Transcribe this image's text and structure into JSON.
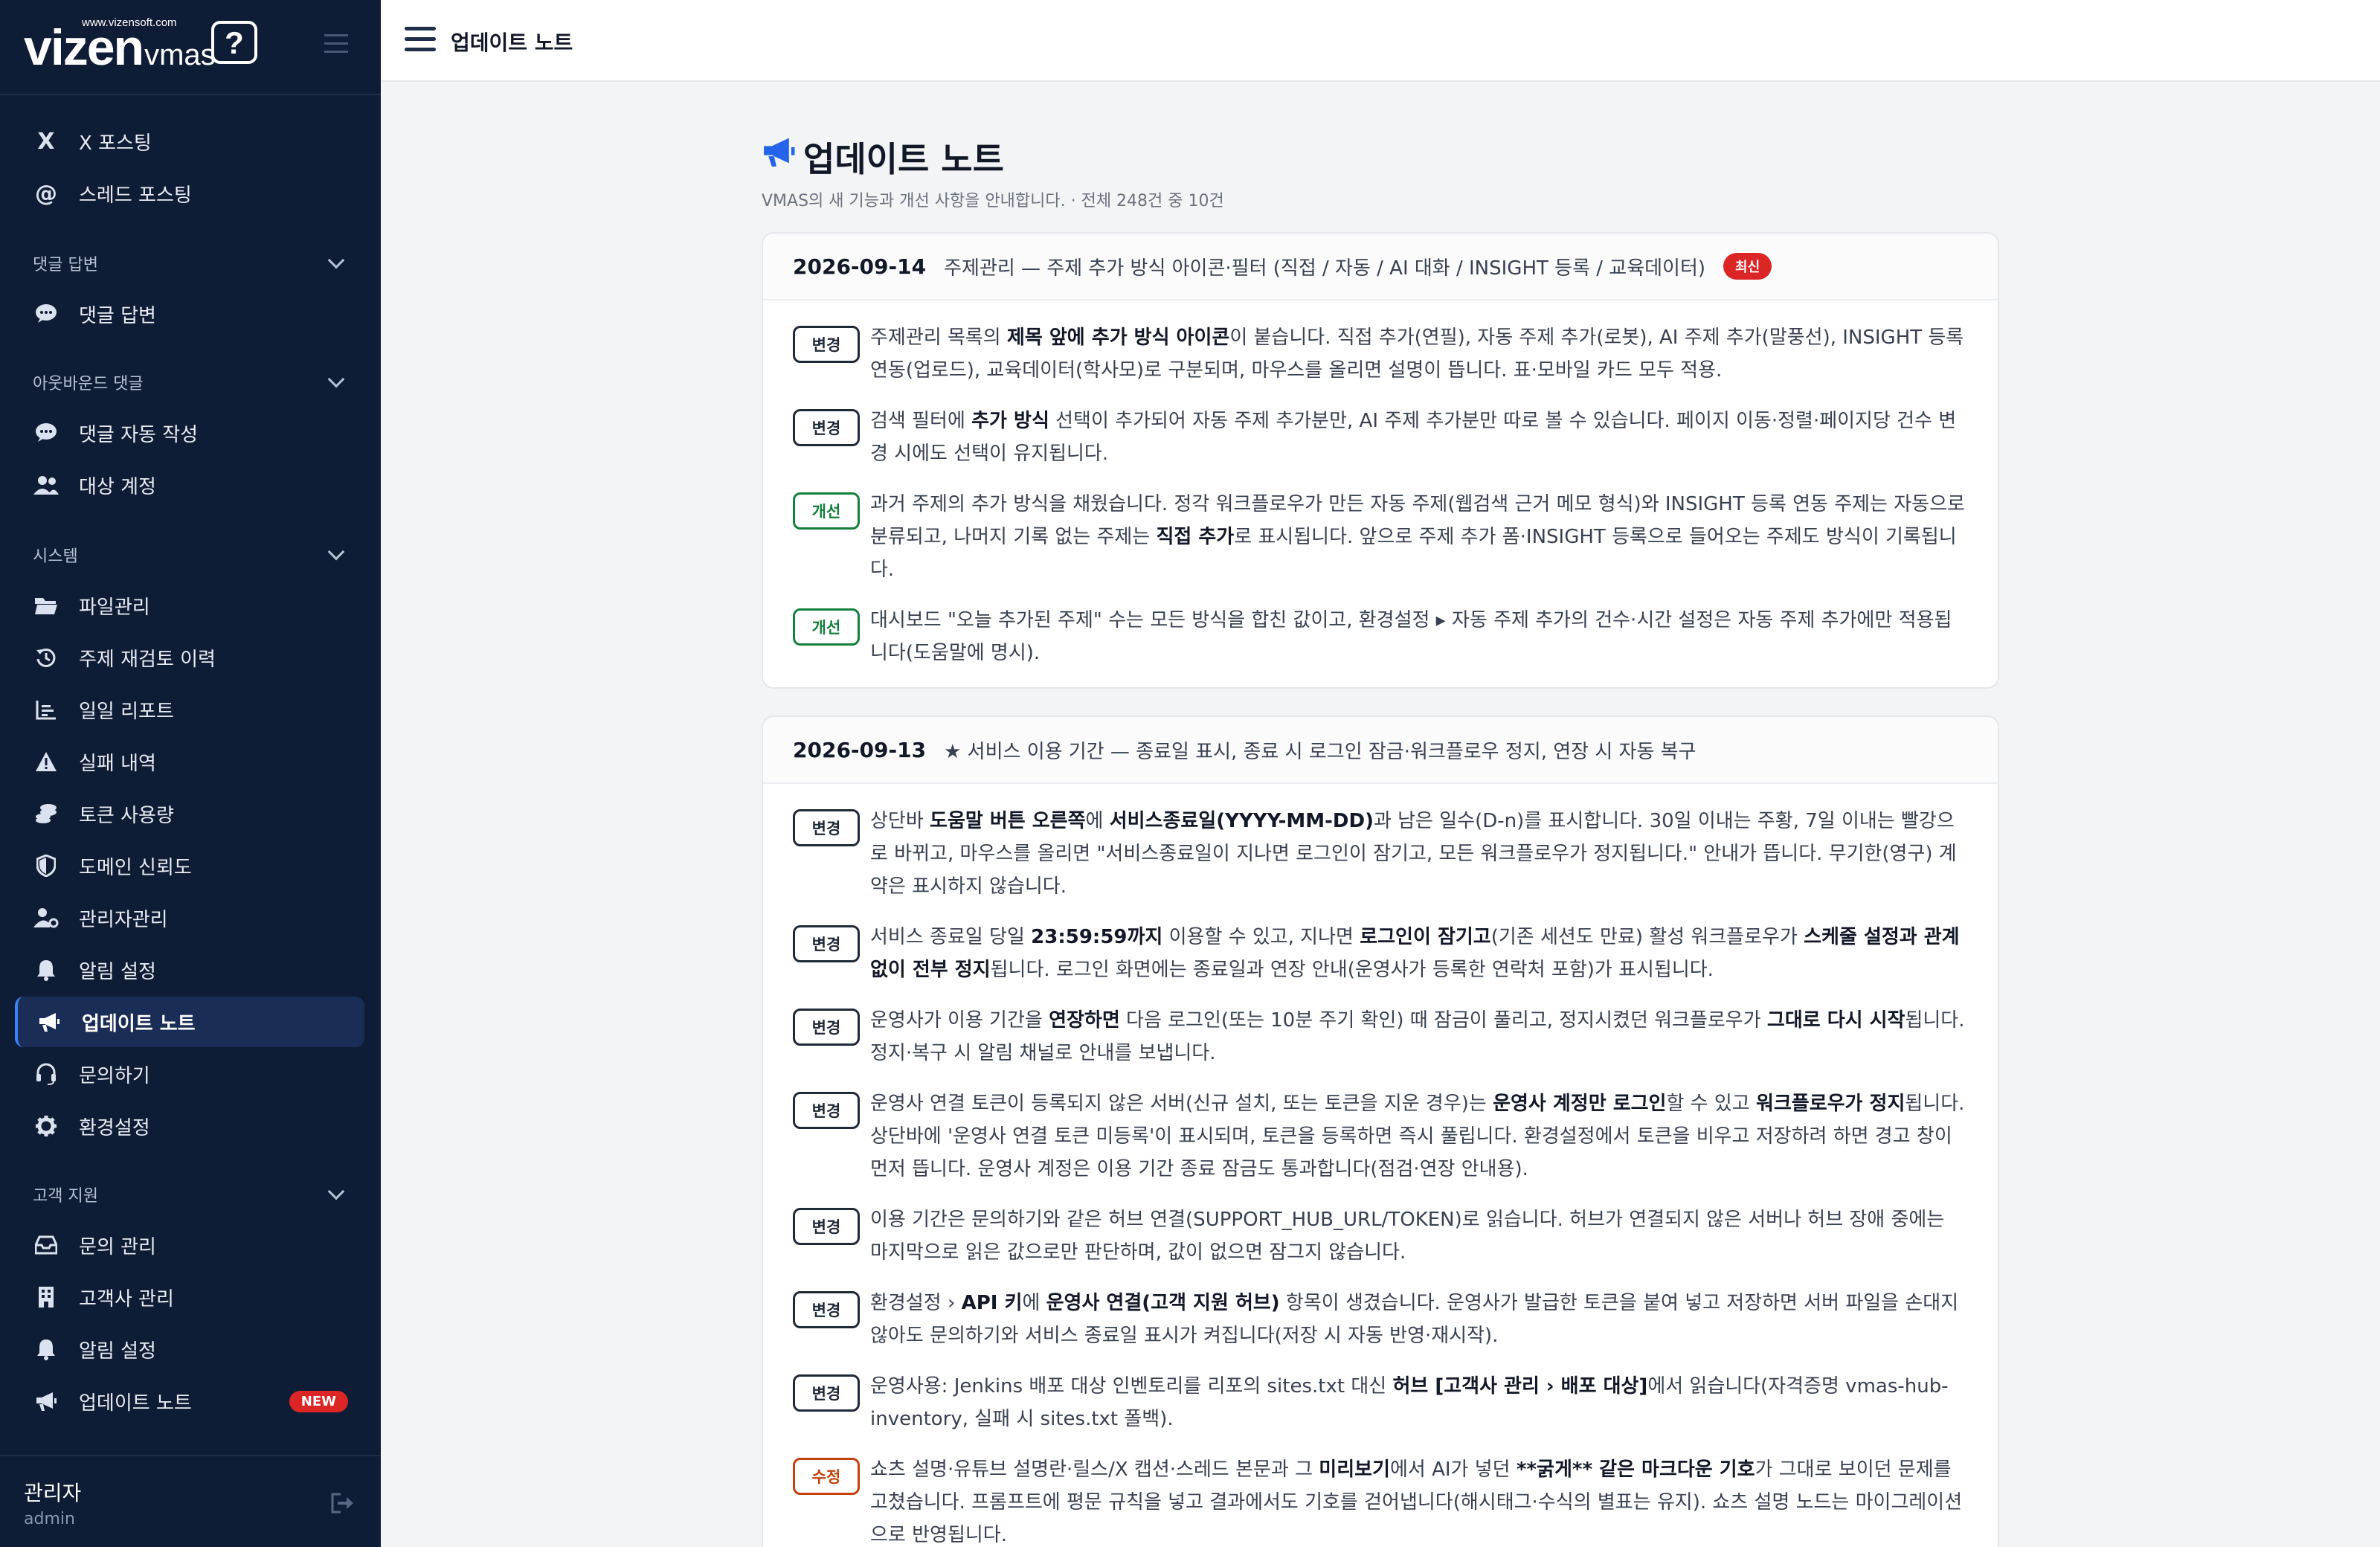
{
  "brand": {
    "url": "www.vizensoft.com",
    "name": "vizen",
    "product": "vmas",
    "bubble": "?"
  },
  "sidebar": {
    "items_top": [
      {
        "label": "X 포스팅",
        "icon": "x-icon"
      },
      {
        "label": "스레드 포스팅",
        "icon": "at-icon"
      }
    ],
    "section_comment": "댓글 답변",
    "comment_items": [
      {
        "label": "댓글 답변",
        "icon": "comment-icon"
      }
    ],
    "section_outbound": "아웃바운드 댓글",
    "outbound_items": [
      {
        "label": "댓글 자동 작성",
        "icon": "comment-icon"
      },
      {
        "label": "대상 계정",
        "icon": "users-icon"
      }
    ],
    "section_system": "시스템",
    "system_items": [
      {
        "label": "파일관리",
        "icon": "folder-icon"
      },
      {
        "label": "주제 재검토 이력",
        "icon": "history-icon"
      },
      {
        "label": "일일 리포트",
        "icon": "chart-icon"
      },
      {
        "label": "실패 내역",
        "icon": "warning-icon"
      },
      {
        "label": "토큰 사용량",
        "icon": "coins-icon"
      },
      {
        "label": "도메인 신뢰도",
        "icon": "shield-icon"
      },
      {
        "label": "관리자관리",
        "icon": "user-gear-icon"
      },
      {
        "label": "알림 설정",
        "icon": "bell-icon"
      },
      {
        "label": "업데이트 노트",
        "icon": "megaphone-icon"
      },
      {
        "label": "문의하기",
        "icon": "headset-icon"
      },
      {
        "label": "환경설정",
        "icon": "gear-icon"
      }
    ],
    "section_support": "고객 지원",
    "support_items": [
      {
        "label": "문의 관리",
        "icon": "inbox-icon"
      },
      {
        "label": "고객사 관리",
        "icon": "building-icon"
      },
      {
        "label": "알림 설정",
        "icon": "bell-icon"
      },
      {
        "label": "업데이트 노트",
        "icon": "megaphone-icon",
        "badge": "NEW"
      }
    ]
  },
  "user": {
    "name": "관리자",
    "id": "admin"
  },
  "topbar": {
    "title": "업데이트 노트"
  },
  "page": {
    "title": "업데이트 노트",
    "subtitle": "VMAS의 새 기능과 개선 사항을 안내합니다. · 전체 248건 중 10건"
  },
  "tags": {
    "change": "변경",
    "improve": "개선",
    "fix": "수정"
  },
  "cards": [
    {
      "date": "2026-09-14",
      "title": "주제관리 — 주제 추가 방식 아이콘·필터 (직접 / 자동 / AI 대화 / INSIGHT 등록 / 교육데이터)",
      "badge": "최신",
      "entries": [
        {
          "tag": "변경",
          "text": "주제관리 목록의 제목 앞에 추가 방식 아이콘이 붙습니다. 직접 추가(연필), 자동 주제 추가(로봇), AI 주제 추가(말풍선), INSIGHT 등록 연동(업로드), 교육데이터(학사모)로 구분되며, 마우스를 올리면 설명이 뜹니다. 표·모바일 카드 모두 적용."
        },
        {
          "tag": "변경",
          "text": "검색 필터에 추가 방식 선택이 추가되어 자동 주제 추가분만, AI 주제 추가분만 따로 볼 수 있습니다. 페이지 이동·정렬·페이지당 건수 변경 시에도 선택이 유지됩니다."
        },
        {
          "tag": "개선",
          "text": "과거 주제의 추가 방식을 채웠습니다. 정각 워크플로우가 만든 자동 주제(웹검색 근거 메모 형식)와 INSIGHT 등록 연동 주제는 자동으로 분류되고, 나머지 기록 없는 주제는 직접 추가로 표시됩니다. 앞으로 주제 추가 폼·INSIGHT 등록으로 들어오는 주제도 방식이 기록됩니다."
        },
        {
          "tag": "개선",
          "text": "대시보드 \"오늘 추가된 주제\" 수는 모든 방식을 합친 값이고, 환경설정 ▸ 자동 주제 추가의 건수·시간 설정은 자동 주제 추가에만 적용됩니다(도움말에 명시)."
        }
      ]
    },
    {
      "date": "2026-09-13",
      "title": "★ 서비스 이용 기간 — 종료일 표시, 종료 시 로그인 잠금·워크플로우 정지, 연장 시 자동 복구",
      "entries": [
        {
          "tag": "변경",
          "text": "상단바 도움말 버튼 오른쪽에 서비스종료일(YYYY-MM-DD)과 남은 일수(D-n)를 표시합니다. 30일 이내는 주황, 7일 이내는 빨강으로 바뀌고, 마우스를 올리면 \"서비스종료일이 지나면 로그인이 잠기고, 모든 워크플로우가 정지됩니다.\" 안내가 뜹니다. 무기한(영구) 계약은 표시하지 않습니다."
        },
        {
          "tag": "변경",
          "text": "서비스 종료일 당일 23:59:59까지 이용할 수 있고, 지나면 로그인이 잠기고(기존 세션도 만료) 활성 워크플로우가 스케줄 설정과 관계없이 전부 정지됩니다. 로그인 화면에는 종료일과 연장 안내(운영사가 등록한 연락처 포함)가 표시됩니다."
        },
        {
          "tag": "변경",
          "text": "운영사가 이용 기간을 연장하면 다음 로그인(또는 10분 주기 확인) 때 잠금이 풀리고, 정지시켰던 워크플로우가 그대로 다시 시작됩니다. 정지·복구 시 알림 채널로 안내를 보냅니다."
        },
        {
          "tag": "변경",
          "text": "운영사 연결 토큰이 등록되지 않은 서버(신규 설치, 또는 토큰을 지운 경우)는 운영사 계정만 로그인할 수 있고 워크플로우가 정지됩니다. 상단바에 '운영사 연결 토큰 미등록'이 표시되며, 토큰을 등록하면 즉시 풀립니다. 환경설정에서 토큰을 비우고 저장하려 하면 경고 창이 먼저 뜹니다. 운영사 계정은 이용 기간 종료 잠금도 통과합니다(점검·연장 안내용)."
        },
        {
          "tag": "변경",
          "text": "이용 기간은 문의하기와 같은 허브 연결(SUPPORT_HUB_URL/TOKEN)로 읽습니다. 허브가 연결되지 않은 서버나 허브 장애 중에는 마지막으로 읽은 값으로만 판단하며, 값이 없으면 잠그지 않습니다."
        },
        {
          "tag": "변경",
          "text": "환경설정 › API 키에 운영사 연결(고객 지원 허브) 항목이 생겼습니다. 운영사가 발급한 토큰을 붙여 넣고 저장하면 서버 파일을 손대지 않아도 문의하기와 서비스 종료일 표시가 켜집니다(저장 시 자동 반영·재시작)."
        },
        {
          "tag": "변경",
          "text": "운영사용: Jenkins 배포 대상 인벤토리를 리포의 sites.txt 대신 허브 [고객사 관리 › 배포 대상]에서 읽습니다(자격증명 vmas-hub-inventory, 실패 시 sites.txt 폴백)."
        },
        {
          "tag": "수정",
          "text": "쇼츠 설명·유튜브 설명란·릴스/X 캡션·스레드 본문과 그 미리보기에서 AI가 넣던 **굵게** 같은 마크다운 기호가 그대로 보이던 문제를 고쳤습니다. 프롬프트에 평문 규칙을 넣고 결과에서도 기호를 걷어냅니다(해시태그·수식의 별표는 유지). 쇼츠 설명 노드는 마이그레이션으로 반영됩니다."
        }
      ]
    }
  ]
}
